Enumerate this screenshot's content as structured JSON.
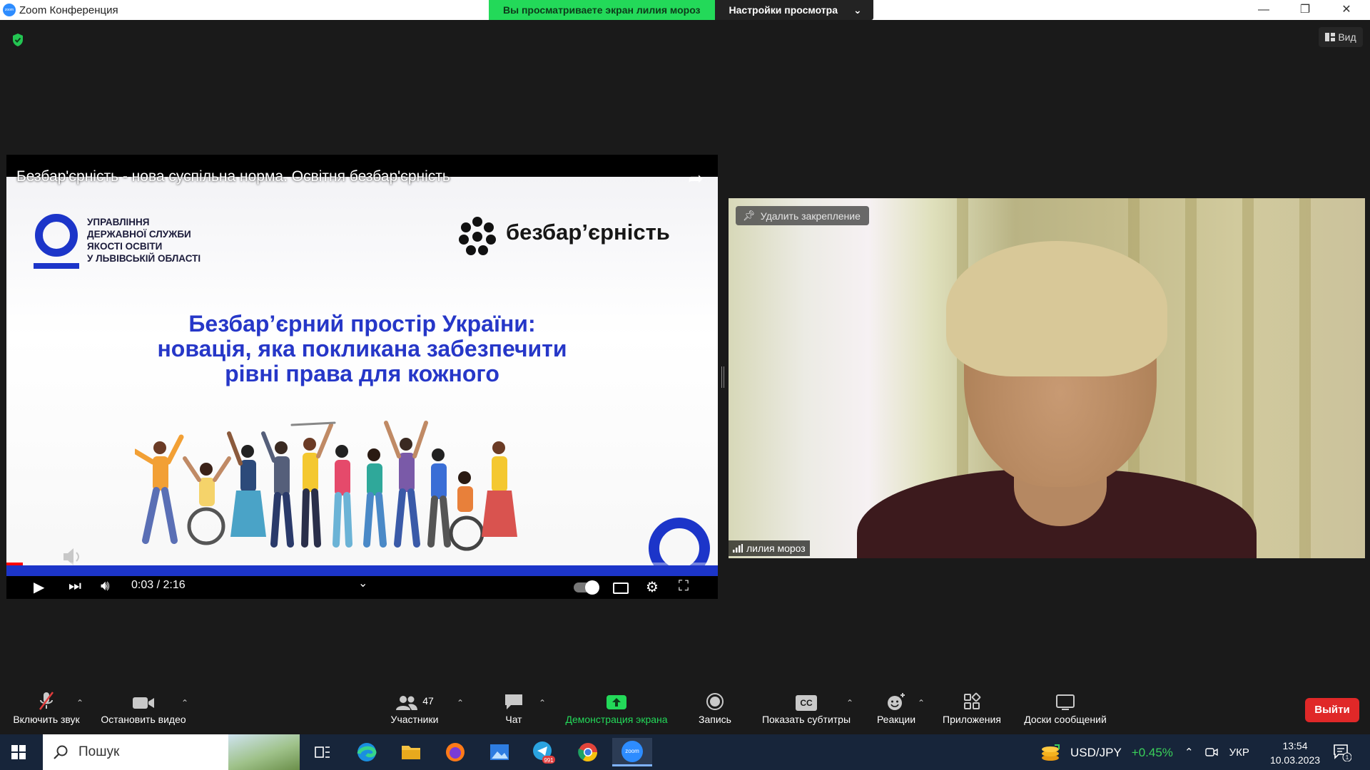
{
  "window": {
    "title": "Zoom Конференция",
    "app_icon_text": "zoom",
    "controls": {
      "minimize": "—",
      "restore": "❐",
      "close": "✕"
    }
  },
  "share_banner": {
    "viewing_text": "Вы просматриваете экран лилия мороз",
    "view_options_label": "Настройки просмотра"
  },
  "view_button": {
    "label": "Вид"
  },
  "shared_video": {
    "title": "Безбар'єрність - нова суспільна норма. Освітня безбар'єрність",
    "org_lines": [
      "УПРАВЛІННЯ",
      "ДЕРЖАВНОЇ СЛУЖБИ",
      "ЯКОСТІ ОСВІТИ",
      "У ЛЬВІВСЬКІЙ ОБЛАСТІ"
    ],
    "brand_label": "безбар’єрність",
    "headline_lines": [
      "Безбар’єрний простір України:",
      "новація, яка покликана забезпечити",
      "рівні права для кожного"
    ],
    "time": "0:03 / 2:16",
    "progress_fraction": 0.023,
    "accent_color": "#1c35c9"
  },
  "participant": {
    "unpin_label": "Удалить закрепление",
    "name": "лилия мороз"
  },
  "toolbar": {
    "items": [
      {
        "label": "Включить звук",
        "icon": "muted-mic-icon"
      },
      {
        "label": "Остановить видео",
        "icon": "video-camera-icon"
      },
      {
        "label": "Участники",
        "icon": "participants-icon",
        "count": "47"
      },
      {
        "label": "Чат",
        "icon": "chat-icon"
      },
      {
        "label": "Демонстрация экрана",
        "icon": "share-screen-icon",
        "color": "#23d959"
      },
      {
        "label": "Запись",
        "icon": "record-icon"
      },
      {
        "label": "Показать субтитры",
        "icon": "closed-captions-icon",
        "badge": "CC"
      },
      {
        "label": "Реакции",
        "icon": "reactions-icon"
      },
      {
        "label": "Приложения",
        "icon": "apps-icon"
      },
      {
        "label": "Доски сообщений",
        "icon": "whiteboard-icon"
      }
    ],
    "leave_label": "Выйти"
  },
  "taskbar": {
    "search_placeholder": "Пошук",
    "telegram_badge": "991",
    "zoom_label": "zoom",
    "ticker_symbol": "USD/JPY",
    "ticker_change": "+0.45%",
    "language": "УКР",
    "time": "13:54",
    "date": "10.03.2023",
    "notification_count": "1"
  }
}
